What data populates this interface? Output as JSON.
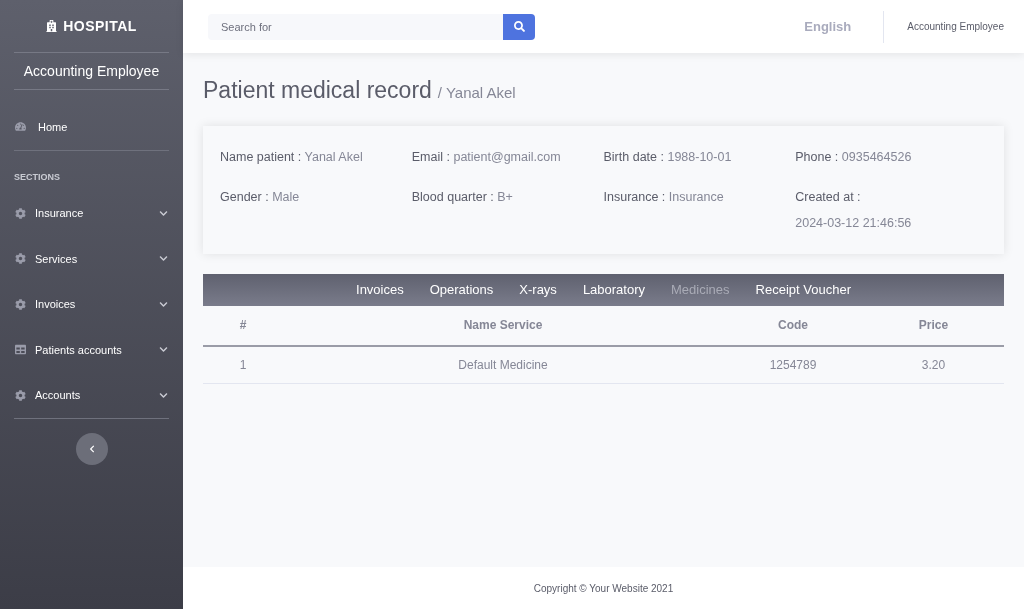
{
  "sidebar": {
    "brand": "HOSPITAL",
    "user": "Accounting Employee",
    "items": [
      {
        "label": "Home",
        "kind": "dashboard",
        "expandable": false
      },
      {
        "kind": "heading",
        "label": "SECTIONS"
      },
      {
        "label": "Insurance",
        "kind": "gear",
        "expandable": true
      },
      {
        "label": "Services",
        "kind": "gear",
        "expandable": true
      },
      {
        "label": "Invoices",
        "kind": "gear",
        "expandable": true
      },
      {
        "label": "Patients accounts",
        "kind": "table",
        "expandable": true
      },
      {
        "label": "Accounts",
        "kind": "gear",
        "expandable": true
      }
    ]
  },
  "topbar": {
    "search": {
      "placeholder": "Search for"
    },
    "language": "English",
    "user": "Accounting Employee"
  },
  "page": {
    "title": "Patient medical record",
    "subtitle": "/ Yanal Akel"
  },
  "info": [
    {
      "label": "Name patient :",
      "value": "Yanal Akel"
    },
    {
      "label": "Email :",
      "value": "patient@gmail.com"
    },
    {
      "label": "Birth date :",
      "value": "1988-10-01"
    },
    {
      "label": "Phone :",
      "value": "0935464526"
    },
    {
      "label": "Gender :",
      "value": "Male"
    },
    {
      "label": "Blood quarter :",
      "value": "B+"
    },
    {
      "label": "Insurance :",
      "value": "Insurance"
    },
    {
      "label": "Created at :",
      "value": "2024-03-12 21:46:56"
    }
  ],
  "tabs": [
    {
      "label": "Invoices",
      "selected": false
    },
    {
      "label": "Operations",
      "selected": false
    },
    {
      "label": "X-rays",
      "selected": false
    },
    {
      "label": "Laboratory",
      "selected": false
    },
    {
      "label": "Medicines",
      "selected": true
    },
    {
      "label": "Receipt Voucher",
      "selected": false
    }
  ],
  "table": {
    "columns": [
      "#",
      "Name Service",
      "Code",
      "Price"
    ],
    "rows": [
      [
        "1",
        "Default Medicine",
        "1254789",
        "3.20"
      ]
    ]
  },
  "footer": "Copyright © Your Website 2021"
}
